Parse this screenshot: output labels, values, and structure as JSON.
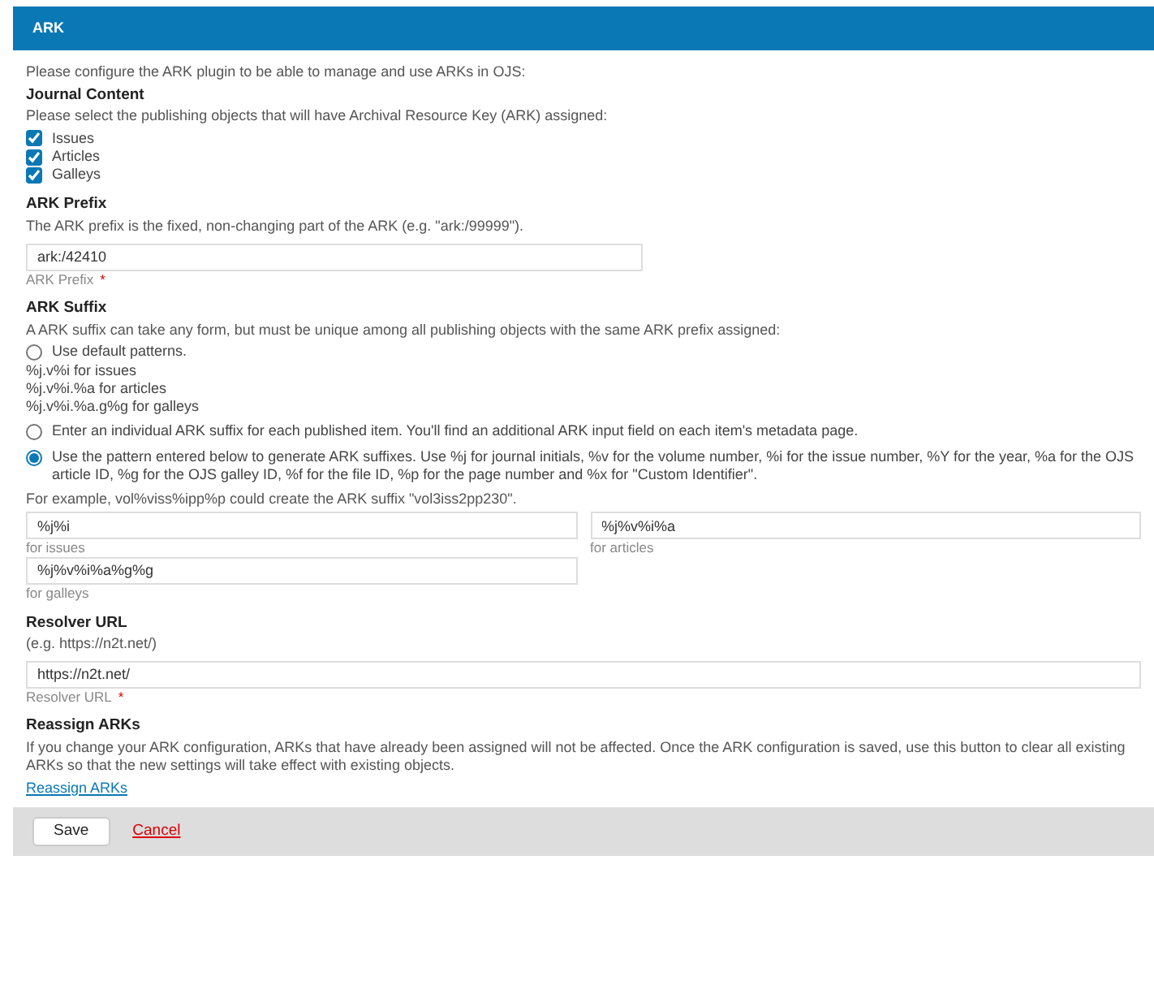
{
  "header": {
    "title": "ARK"
  },
  "intro": "Please configure the ARK plugin to be able to manage and use ARKs in OJS:",
  "journal_content": {
    "title": "Journal Content",
    "description": "Please select the publishing objects that will have Archival Resource Key (ARK) assigned:",
    "options": [
      {
        "label": "Issues",
        "checked": true
      },
      {
        "label": "Articles",
        "checked": true
      },
      {
        "label": "Galleys",
        "checked": true
      }
    ]
  },
  "prefix": {
    "title": "ARK Prefix",
    "description": "The ARK prefix is the fixed, non-changing part of the ARK (e.g. \"ark:/99999\").",
    "value": "ark:/42410",
    "label": "ARK Prefix",
    "required_mark": "*"
  },
  "suffix": {
    "title": "ARK Suffix",
    "description": "A ARK suffix can take any form, but must be unique among all publishing objects with the same ARK prefix assigned:",
    "options": [
      {
        "label": "Use default patterns.",
        "selected": false,
        "notes": [
          "%j.v%i for issues",
          "%j.v%i.%a for articles",
          "%j.v%i.%a.g%g for galleys"
        ]
      },
      {
        "label": "Enter an individual ARK suffix for each published item. You'll find an additional ARK input field on each item's metadata page.",
        "selected": false
      },
      {
        "label": "Use the pattern entered below to generate ARK suffixes. Use %j for journal initials, %v for the volume number, %i for the issue number, %Y for the year, %a for the OJS article ID, %g for the OJS galley ID, %f for the file ID, %p for the page number and %x for \"Custom Identifier\".",
        "selected": true
      }
    ],
    "example": "For example, vol%viss%ipp%p could create the ARK suffix \"vol3iss2pp230\".",
    "fields": [
      {
        "value": "%j%i",
        "label": "for issues"
      },
      {
        "value": "%j%v%i%a",
        "label": "for articles"
      },
      {
        "value": "%j%v%i%a%g%g",
        "label": "for galleys"
      }
    ]
  },
  "resolver": {
    "title": "Resolver URL",
    "description": "(e.g. https://n2t.net/)",
    "value": "https://n2t.net/",
    "label": "Resolver URL",
    "required_mark": "*"
  },
  "reassign": {
    "title": "Reassign ARKs",
    "description": "If you change your ARK configuration, ARKs that have already been assigned will not be affected. Once the ARK configuration is saved, use this button to clear all existing ARKs so that the new settings will take effect with existing objects.",
    "link": "Reassign ARKs"
  },
  "footer": {
    "save": "Save",
    "cancel": "Cancel"
  }
}
